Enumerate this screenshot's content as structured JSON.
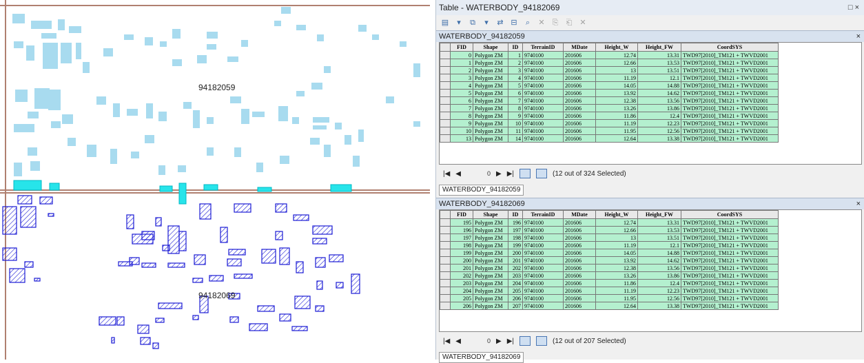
{
  "map": {
    "upper_tile_label": "94182059",
    "lower_tile_label": "94182069",
    "colors": {
      "upper_fill": "#a8dbef",
      "selected_fill": "#27e4ea",
      "lower_stroke": "#1b1bd4",
      "grid_line": "#b08070"
    }
  },
  "window": {
    "title": "Table - WATERBODY_94182069",
    "close_label": "□ ×"
  },
  "toolbar": {
    "icons": [
      "table-options-icon",
      "related-tables-icon",
      "select-by-attributes-icon",
      "switch-selection-icon",
      "clear-selection-icon",
      "zoom-to-selected-icon",
      "delete-selected-icon",
      "copy-icon",
      "paste-icon",
      "field-calc-icon",
      "delete-field-icon"
    ]
  },
  "tables": [
    {
      "name": "WATERBODY_94182059",
      "close": "×",
      "columns": [
        "FID",
        "Shape",
        "ID",
        "TerrainID",
        "MDate",
        "Height_W",
        "Height_FW",
        "CoordSYS"
      ],
      "rows": [
        [
          "0",
          "Polygon ZM",
          "1",
          "9740100",
          "201606",
          "12.74",
          "13.31",
          "TWD97[2010]_TM121 + TWVD2001"
        ],
        [
          "1",
          "Polygon ZM",
          "2",
          "9740100",
          "201606",
          "12.66",
          "13.53",
          "TWD97[2010]_TM121 + TWVD2001"
        ],
        [
          "2",
          "Polygon ZM",
          "3",
          "9740100",
          "201606",
          "13",
          "13.51",
          "TWD97[2010]_TM121 + TWVD2001"
        ],
        [
          "3",
          "Polygon ZM",
          "4",
          "9740100",
          "201606",
          "11.19",
          "12.1",
          "TWD97[2010]_TM121 + TWVD2001"
        ],
        [
          "4",
          "Polygon ZM",
          "5",
          "9740100",
          "201606",
          "14.05",
          "14.88",
          "TWD97[2010]_TM121 + TWVD2001"
        ],
        [
          "5",
          "Polygon ZM",
          "6",
          "9740100",
          "201606",
          "13.92",
          "14.62",
          "TWD97[2010]_TM121 + TWVD2001"
        ],
        [
          "6",
          "Polygon ZM",
          "7",
          "9740100",
          "201606",
          "12.38",
          "13.56",
          "TWD97[2010]_TM121 + TWVD2001"
        ],
        [
          "7",
          "Polygon ZM",
          "8",
          "9740100",
          "201606",
          "13.26",
          "13.86",
          "TWD97[2010]_TM121 + TWVD2001"
        ],
        [
          "8",
          "Polygon ZM",
          "9",
          "9740100",
          "201606",
          "11.86",
          "12.4",
          "TWD97[2010]_TM121 + TWVD2001"
        ],
        [
          "9",
          "Polygon ZM",
          "10",
          "9740100",
          "201606",
          "11.19",
          "12.23",
          "TWD97[2010]_TM121 + TWVD2001"
        ],
        [
          "10",
          "Polygon ZM",
          "11",
          "9740100",
          "201606",
          "11.95",
          "12.56",
          "TWD97[2010]_TM121 + TWVD2001"
        ],
        [
          "13",
          "Polygon ZM",
          "14",
          "9740100",
          "201606",
          "12.64",
          "13.38",
          "TWD97[2010]_TM121 + TWVD2001"
        ]
      ],
      "nav": {
        "first": "|◀",
        "prev": "◀",
        "current": "0",
        "next": "▶",
        "last": "▶|",
        "status": "(12 out of 324 Selected)"
      },
      "tab_label": "WATERBODY_94182059"
    },
    {
      "name": "WATERBODY_94182069",
      "close": "×",
      "columns": [
        "FID",
        "Shape",
        "ID",
        "TerrainID",
        "MDate",
        "Height_W",
        "Height_FW",
        "CoordSYS"
      ],
      "rows": [
        [
          "195",
          "Polygon ZM",
          "196",
          "9740100",
          "201606",
          "12.74",
          "13.31",
          "TWD97[2010]_TM121 + TWVD2001"
        ],
        [
          "196",
          "Polygon ZM",
          "197",
          "9740100",
          "201606",
          "12.66",
          "13.53",
          "TWD97[2010]_TM121 + TWVD2001"
        ],
        [
          "197",
          "Polygon ZM",
          "198",
          "9740100",
          "201606",
          "13",
          "13.51",
          "TWD97[2010]_TM121 + TWVD2001"
        ],
        [
          "198",
          "Polygon ZM",
          "199",
          "9740100",
          "201606",
          "11.19",
          "12.1",
          "TWD97[2010]_TM121 + TWVD2001"
        ],
        [
          "199",
          "Polygon ZM",
          "200",
          "9740100",
          "201606",
          "14.05",
          "14.88",
          "TWD97[2010]_TM121 + TWVD2001"
        ],
        [
          "200",
          "Polygon ZM",
          "201",
          "9740100",
          "201606",
          "13.92",
          "14.62",
          "TWD97[2010]_TM121 + TWVD2001"
        ],
        [
          "201",
          "Polygon ZM",
          "202",
          "9740100",
          "201606",
          "12.38",
          "13.56",
          "TWD97[2010]_TM121 + TWVD2001"
        ],
        [
          "202",
          "Polygon ZM",
          "203",
          "9740100",
          "201606",
          "13.26",
          "13.86",
          "TWD97[2010]_TM121 + TWVD2001"
        ],
        [
          "203",
          "Polygon ZM",
          "204",
          "9740100",
          "201606",
          "11.86",
          "12.4",
          "TWD97[2010]_TM121 + TWVD2001"
        ],
        [
          "204",
          "Polygon ZM",
          "205",
          "9740100",
          "201606",
          "11.19",
          "12.23",
          "TWD97[2010]_TM121 + TWVD2001"
        ],
        [
          "205",
          "Polygon ZM",
          "206",
          "9740100",
          "201606",
          "11.95",
          "12.56",
          "TWD97[2010]_TM121 + TWVD2001"
        ],
        [
          "206",
          "Polygon ZM",
          "207",
          "9740100",
          "201606",
          "12.64",
          "13.38",
          "TWD97[2010]_TM121 + TWVD2001"
        ]
      ],
      "nav": {
        "first": "|◀",
        "prev": "◀",
        "current": "0",
        "next": "▶",
        "last": "▶|",
        "status": "(12 out of 207 Selected)"
      },
      "tab_label": "WATERBODY_94182069"
    }
  ]
}
